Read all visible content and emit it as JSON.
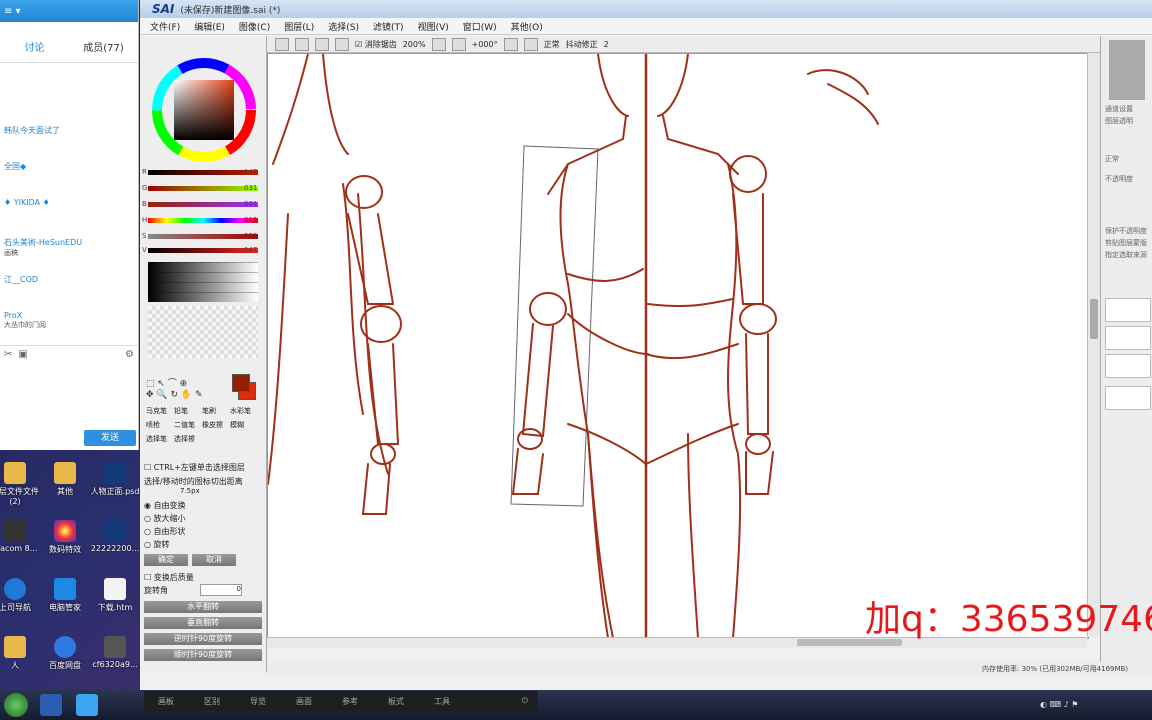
{
  "chat": {
    "tab_discuss": "讨论",
    "tab_members": "成员(77)",
    "members": [
      {
        "name": "韩队今天面试了",
        "sub": ""
      },
      {
        "name": "全国◆",
        "sub": ""
      },
      {
        "name": "♦ YIKIDA ♦",
        "sub": ""
      },
      {
        "name": "石头美術-HeSunEDU",
        "sub": "画稿"
      },
      {
        "name": "江__COD",
        "sub": ""
      },
      {
        "name": "ProX",
        "sub": "大丛巾的门阅"
      }
    ],
    "send_label": "发送"
  },
  "desktop": {
    "icons": [
      {
        "label": "图层文件文件(2)"
      },
      {
        "label": "其他"
      },
      {
        "label": "人物正面.psd"
      },
      {
        "label": "Wacom 8..."
      },
      {
        "label": "数码特效"
      },
      {
        "label": "22222200..."
      },
      {
        "label": "上司导航"
      },
      {
        "label": "电脑管家"
      },
      {
        "label": "下载.htm"
      },
      {
        "label": "人"
      },
      {
        "label": "百度网盘"
      },
      {
        "label": "cf6320a9..."
      }
    ]
  },
  "sai": {
    "logo": "SAI",
    "doc_title": "(未保存)新建图像.sai (*)",
    "menus": [
      "文件(F)",
      "编辑(E)",
      "图像(C)",
      "图层(L)",
      "选择(S)",
      "滤镜(T)",
      "视图(V)",
      "窗口(W)",
      "其他(O)"
    ],
    "toolbar": {
      "antialias": "消除锯齿",
      "zoom": "200%",
      "angle": "+000°",
      "mode": "正常",
      "stabilizer_label": "抖动修正",
      "stabilizer_value": "2"
    },
    "color_sliders": [
      {
        "label": "R",
        "value": "147"
      },
      {
        "label": "G",
        "value": "031"
      },
      {
        "label": "B",
        "value": "001"
      },
      {
        "label": "H",
        "value": "012"
      },
      {
        "label": "S",
        "value": "255"
      },
      {
        "label": "V",
        "value": "147"
      }
    ],
    "tool_labels": [
      "马克笔",
      "铅笔",
      "笔刷",
      "水彩笔",
      "喷枪",
      "二值笔",
      "橡皮擦",
      "模糊",
      "选择笔",
      "选择擦"
    ],
    "options": {
      "ctrl_hint": "CTRL+左键单击选择图层",
      "move_hint": "选择/移动时的图标切出距离",
      "move_value": "7.5px",
      "radios": [
        "自由变换",
        "放大缩小",
        "自由形状",
        "旋转"
      ],
      "ok": "确定",
      "cancel": "取消",
      "quality_label": "变换后质量",
      "rotate_label": "旋转角",
      "rotate_value": "0"
    },
    "action_buttons": [
      "水平翻转",
      "垂直翻转",
      "逆时针90度旋转",
      "顺时针90度旋转"
    ],
    "layer_panel": {
      "label1": "通道设置",
      "label2": "图层透明",
      "label3": "正常",
      "label4": "不透明度",
      "label5": "保护不透明度",
      "label6": "剪贴图层蒙版",
      "label7": "指定选取来源"
    },
    "status": {
      "mem": "内存使用率: 30% (已用302MB/可用4169MB)"
    }
  },
  "watermark": "加q：336539746",
  "taskbar": {
    "canvas_tabs": [
      "画板",
      "区别",
      "导览",
      "画面",
      "参考",
      "板式",
      "工具"
    ]
  }
}
